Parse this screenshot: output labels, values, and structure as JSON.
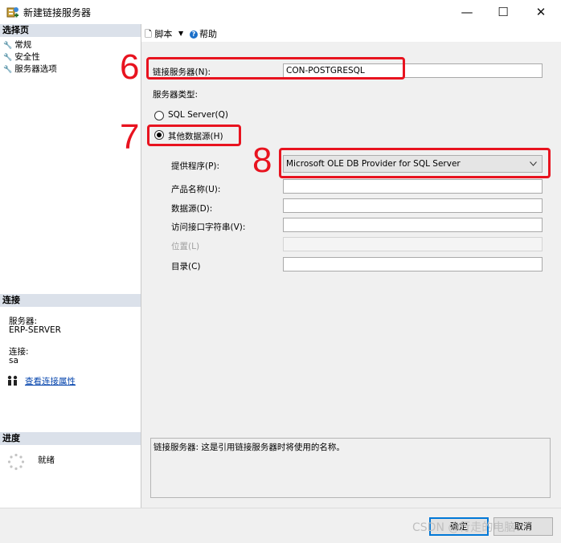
{
  "window": {
    "title": "新建链接服务器",
    "icon": "database-link-icon",
    "minimize_glyph": "—",
    "maximize_glyph": "☐",
    "close_glyph": "✕"
  },
  "left_panel": {
    "select_page_header": "选择页",
    "pages": [
      "常规",
      "安全性",
      "服务器选项"
    ],
    "page_icon": "wrench-icon",
    "connection_header": "连接",
    "server_label": "服务器:",
    "server_value": "ERP-SERVER",
    "connection_label": "连接:",
    "connection_value": "sa",
    "view_props_link": "查看连接属性",
    "progress_header": "进度",
    "progress_status": "就绪"
  },
  "toolbar": {
    "script_label": "脚本",
    "dropdown_glyph": "▼",
    "help_label": "帮助",
    "help_icon_glyph": "?"
  },
  "form": {
    "linked_server_label": "链接服务器(N):",
    "linked_server_value": "CON-POSTGRESQL",
    "server_type_label": "服务器类型:",
    "sql_server_option": "SQL Server(Q)",
    "other_source_option": "其他数据源(H)",
    "selected_option": "other_source",
    "provider_label": "提供程序(P):",
    "provider_value": "Microsoft OLE DB Provider for SQL Server",
    "product_name_label": "产品名称(U):",
    "product_name_value": "",
    "data_source_label": "数据源(D):",
    "data_source_value": "",
    "provider_string_label": "访问接口字符串(V):",
    "provider_string_value": "",
    "location_label": "位置(L)",
    "location_value": "",
    "catalog_label": "目录(C)",
    "catalog_value": ""
  },
  "annotations": {
    "step6": "6",
    "step7": "7",
    "step8": "8",
    "highlight_color": "#e8131f"
  },
  "description": "链接服务器: 这是引用链接服务器时将使用的名称。",
  "footer": {
    "ok_label": "确定",
    "cancel_label": "取消"
  },
  "watermark": "CSDN @行走的电脑"
}
